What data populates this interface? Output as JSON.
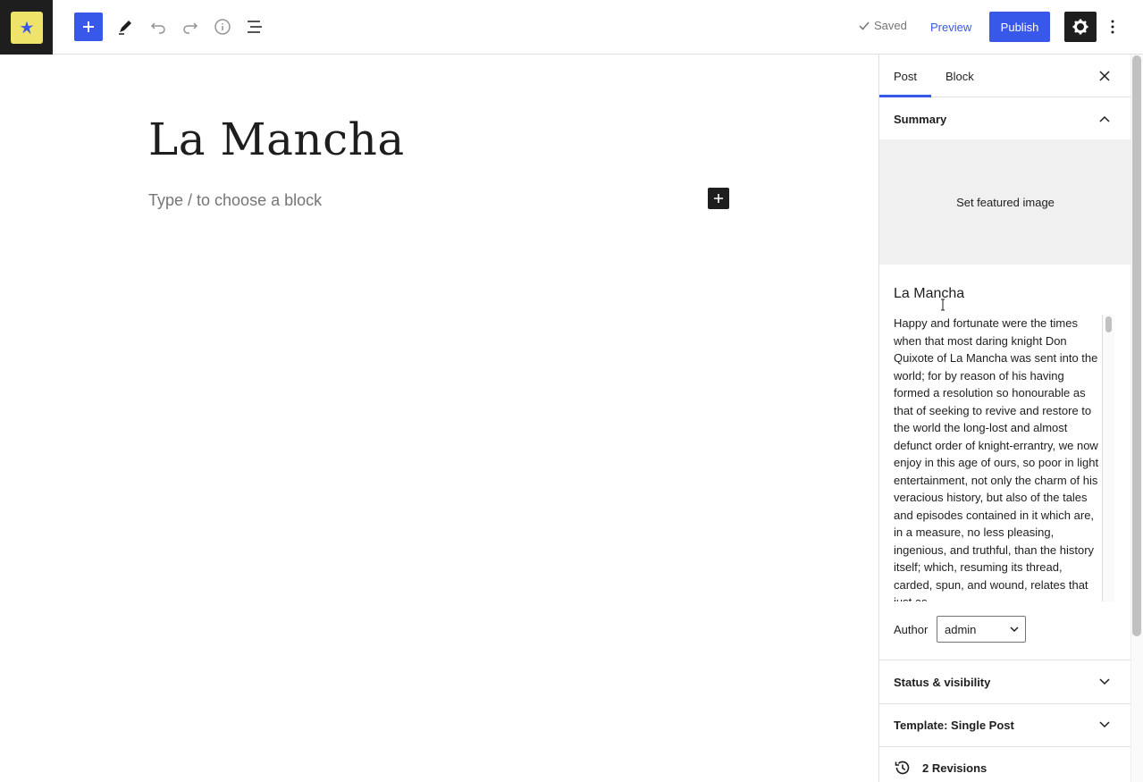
{
  "header": {
    "icons": {
      "site_logo": "wordpress-site-icon",
      "add_block": "plus-icon",
      "tools": "pencil-icon",
      "undo": "undo-icon",
      "redo": "redo-icon",
      "details": "info-icon",
      "list_view": "list-view-icon",
      "settings": "gear-icon",
      "options": "kebab-icon"
    },
    "saved_label": "Saved",
    "preview_label": "Preview",
    "publish_label": "Publish"
  },
  "editor": {
    "title": "La Mancha",
    "block_placeholder": "Type / to choose a block"
  },
  "sidebar": {
    "tabs": [
      {
        "label": "Post",
        "active": true
      },
      {
        "label": "Block",
        "active": false
      }
    ],
    "summary": {
      "heading": "Summary",
      "featured_image_label": "Set featured image",
      "post_title": "La Mancha",
      "excerpt": "Happy and fortunate were the times when that most daring knight Don Quixote of La Mancha was sent into the world; for by reason of his having formed a resolution so honourable as that of seeking to revive and restore to the world the long-lost and almost defunct order of knight-errantry, we now enjoy in this age of ours, so poor in light entertainment, not only the charm of his veracious history, but also of the tales and episodes contained in it which are, in a measure, no less pleasing, ingenious, and truthful, than the history itself; which, resuming its thread, carded, spun, and wound, relates that just as",
      "author_label": "Author",
      "author_value": "admin"
    },
    "status_visibility": "Status & visibility",
    "template": "Template: Single Post",
    "revisions": "2 Revisions"
  },
  "colors": {
    "accent": "#3858e9",
    "dark": "#1e1e1e",
    "logo_bg": "#f0e36a"
  }
}
